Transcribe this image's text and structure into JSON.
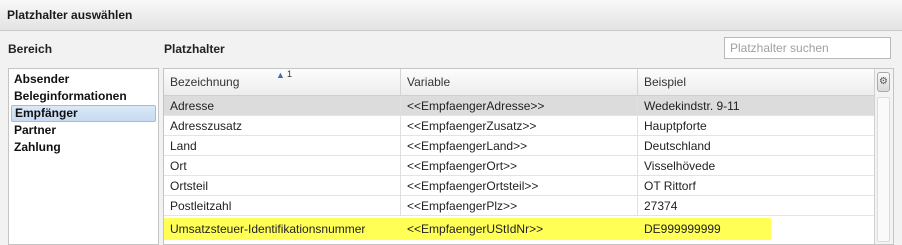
{
  "window": {
    "title": "Platzhalter auswählen"
  },
  "left": {
    "label": "Bereich",
    "items": [
      {
        "label": "Absender",
        "selected": false
      },
      {
        "label": "Beleginformationen",
        "selected": false
      },
      {
        "label": "Empfänger",
        "selected": true
      },
      {
        "label": "Partner",
        "selected": false
      },
      {
        "label": "Zahlung",
        "selected": false
      }
    ]
  },
  "main": {
    "label": "Platzhalter",
    "search": {
      "placeholder": "Platzhalter suchen",
      "value": ""
    },
    "columns": [
      "Bezeichnung",
      "Variable",
      "Beispiel"
    ],
    "sort": {
      "column": "Bezeichnung",
      "direction": "ascending",
      "order": "1"
    },
    "rows": [
      {
        "name": "Adresse",
        "variable": "<<EmpfaengerAdresse>>",
        "example": "Wedekindstr. 9-11",
        "selected": true
      },
      {
        "name": "Adresszusatz",
        "variable": "<<EmpfaengerZusatz>>",
        "example": "Hauptpforte"
      },
      {
        "name": "Land",
        "variable": "<<EmpfaengerLand>>",
        "example": "Deutschland"
      },
      {
        "name": "Ort",
        "variable": "<<EmpfaengerOrt>>",
        "example": "Visselhövede"
      },
      {
        "name": "Ortsteil",
        "variable": "<<EmpfaengerOrtsteil>>",
        "example": "OT Rittorf"
      },
      {
        "name": "Postleitzahl",
        "variable": "<<EmpfaengerPlz>>",
        "example": "27374"
      },
      {
        "name": "Umsatzsteuer-Identifikationsnummer",
        "variable": "<<EmpfaengerUStIdNr>>",
        "example": "DE999999999",
        "highlighted": true
      }
    ],
    "highlight_color": "#ffff55",
    "column_settings_icon": "gear-icon"
  }
}
